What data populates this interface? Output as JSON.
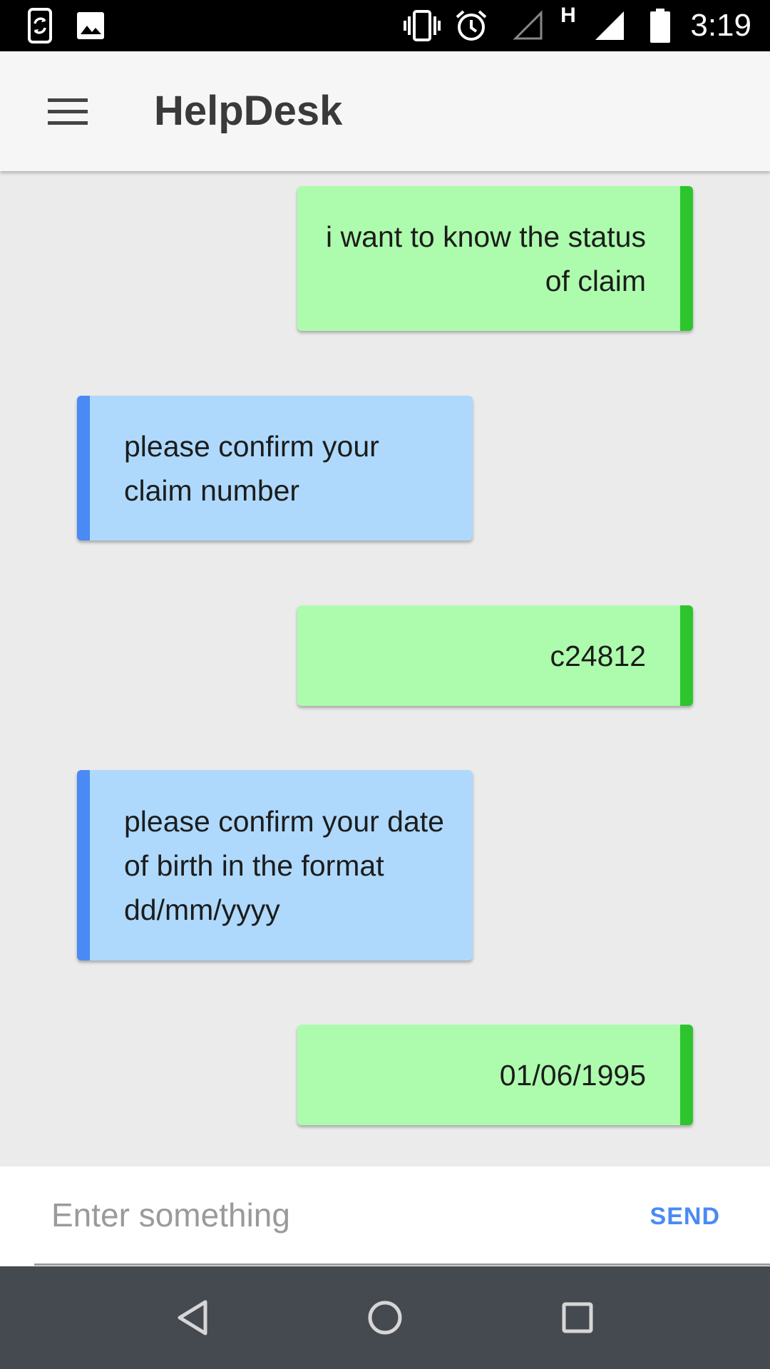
{
  "status_bar": {
    "time": "3:19",
    "icons": [
      "sync-phone-icon",
      "image-icon",
      "vibrate-icon",
      "alarm-icon",
      "no-signal-icon",
      "network-h-icon",
      "signal-icon",
      "battery-icon"
    ],
    "network_type": "H"
  },
  "app_bar": {
    "title": "HelpDesk",
    "menu_icon": "hamburger-menu-icon"
  },
  "messages": [
    {
      "sender": "user",
      "text": "i want to know the status of claim"
    },
    {
      "sender": "bot",
      "text": "please confirm your claim number"
    },
    {
      "sender": "user",
      "text": "c24812"
    },
    {
      "sender": "bot",
      "text": "please confirm your date of birth in the format dd/mm/yyyy"
    },
    {
      "sender": "user",
      "text": "01/06/1995"
    }
  ],
  "input": {
    "placeholder": "Enter something",
    "value": "",
    "send_label": "SEND"
  },
  "nav_bar": {
    "buttons": [
      "back-icon",
      "home-icon",
      "recents-icon"
    ]
  },
  "colors": {
    "user_bubble": "#adfcad",
    "user_accent": "#2dc52d",
    "bot_bubble": "#aed9fc",
    "bot_accent": "#4a8af4",
    "send_label": "#4a8af4",
    "nav_bar": "#454a50"
  }
}
